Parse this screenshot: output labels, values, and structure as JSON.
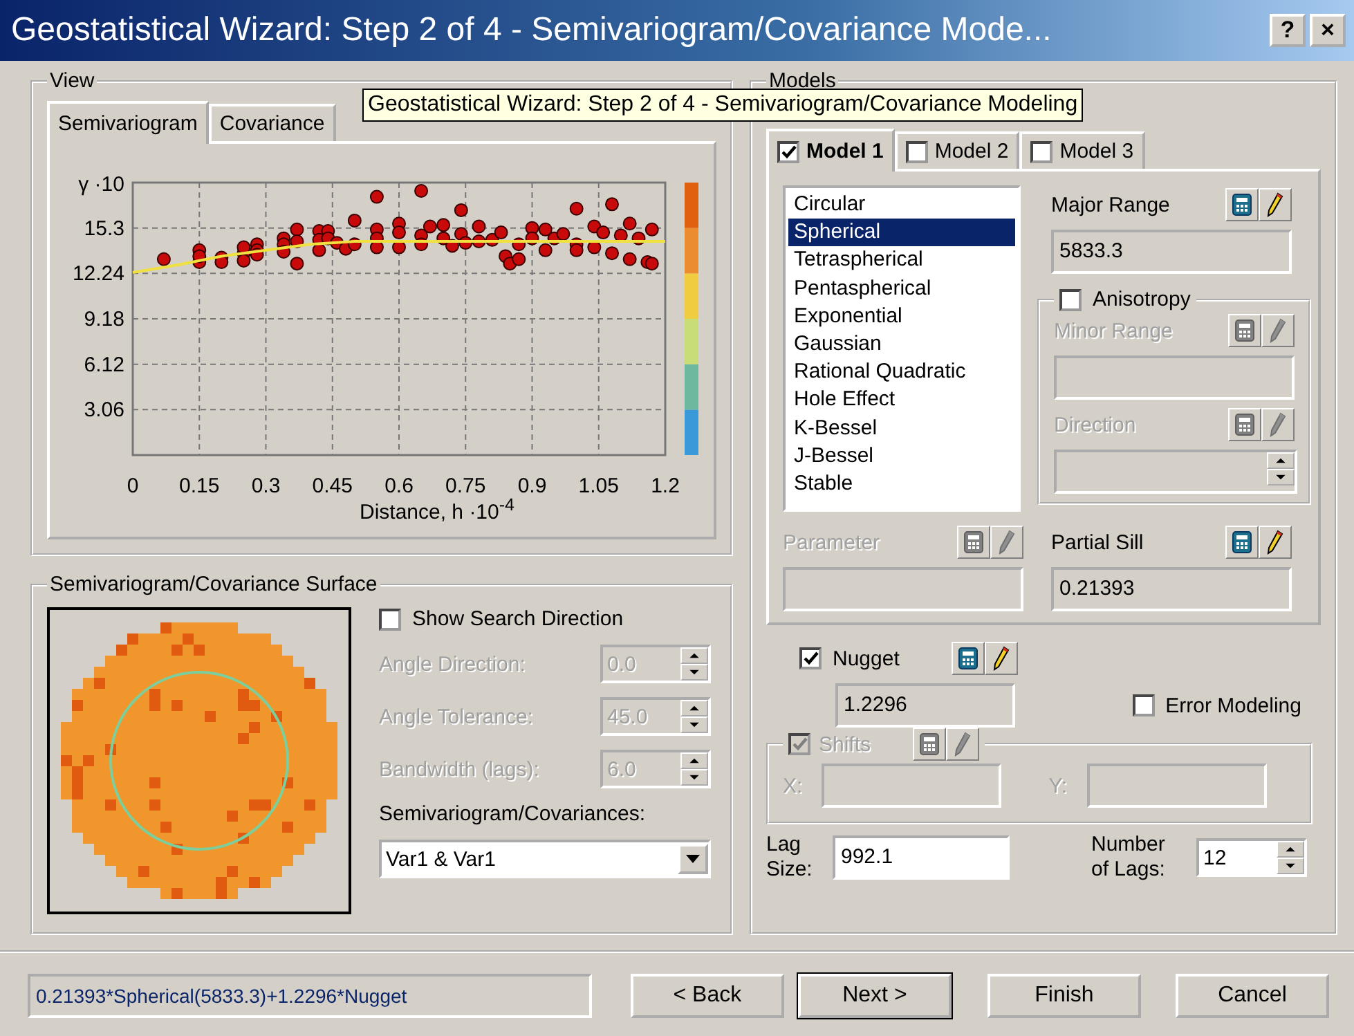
{
  "window": {
    "title": "Geostatistical Wizard: Step 2 of 4 - Semivariogram/Covariance Mode...",
    "help_button": "?",
    "close_button": "×"
  },
  "tooltip": {
    "text": "Geostatistical Wizard: Step 2 of 4 - Semivariogram/Covariance Modeling"
  },
  "view": {
    "title": "View",
    "tabs": [
      {
        "label": "Semivariogram",
        "selected": true
      },
      {
        "label": "Covariance",
        "selected": false
      }
    ],
    "chart_data": {
      "type": "scatter",
      "xlabel": "Distance, h ·10$^{-4}$",
      "ylabel": "γ ·10",
      "grid": true,
      "xlim": [
        0,
        1.2
      ],
      "ylim": [
        0,
        18.36
      ],
      "xticks": [
        0,
        0.15,
        0.3,
        0.45,
        0.6,
        0.75,
        0.9,
        1.05,
        1.2
      ],
      "yticks": [
        3.06,
        6.12,
        9.18,
        12.24,
        15.3
      ],
      "series": [
        {
          "color": "#c80a0a",
          "x": [
            0.07,
            0.15,
            0.15,
            0.15,
            0.2,
            0.2,
            0.25,
            0.25,
            0.25,
            0.28,
            0.28,
            0.28,
            0.34,
            0.34,
            0.34,
            0.37,
            0.37,
            0.37,
            0.42,
            0.42,
            0.42,
            0.44,
            0.44,
            0.46,
            0.48,
            0.5,
            0.5,
            0.55,
            0.55,
            0.55,
            0.55,
            0.6,
            0.6,
            0.6,
            0.65,
            0.65,
            0.65,
            0.67,
            0.7,
            0.7,
            0.72,
            0.74,
            0.74,
            0.75,
            0.78,
            0.78,
            0.81,
            0.83,
            0.84,
            0.85,
            0.87,
            0.87,
            0.9,
            0.9,
            0.93,
            0.93,
            0.95,
            0.97,
            1.0,
            1.0,
            1.0,
            1.04,
            1.04,
            1.06,
            1.08,
            1.08,
            1.1,
            1.12,
            1.12,
            1.14,
            1.16,
            1.17,
            1.17
          ],
          "values": [
            13.2,
            13.8,
            13.0,
            13.4,
            13.3,
            13.0,
            13.6,
            14.0,
            13.1,
            14.2,
            13.8,
            13.5,
            14.6,
            14.2,
            13.7,
            15.2,
            14.4,
            12.9,
            15.1,
            14.5,
            13.8,
            15.1,
            14.6,
            14.3,
            13.9,
            15.8,
            14.2,
            17.4,
            15.2,
            14.6,
            14.0,
            15.6,
            15.0,
            14.0,
            17.8,
            14.8,
            14.2,
            15.4,
            15.5,
            14.6,
            14.1,
            16.5,
            14.9,
            14.3,
            15.4,
            14.4,
            14.5,
            15.0,
            13.4,
            12.9,
            14.2,
            13.2,
            15.3,
            14.6,
            15.2,
            13.8,
            14.6,
            14.9,
            16.6,
            14.2,
            13.8,
            15.4,
            14.0,
            15.0,
            16.9,
            13.6,
            14.8,
            15.6,
            13.2,
            14.6,
            13.0,
            15.2,
            12.9
          ]
        },
        {
          "type": "line",
          "color": "#f0e040",
          "x": [
            0,
            0.1,
            0.2,
            0.3,
            0.4,
            0.5,
            0.6,
            0.7,
            0.9,
            1.2
          ],
          "values": [
            12.3,
            12.8,
            13.4,
            13.8,
            14.2,
            14.4,
            14.4,
            14.4,
            14.4,
            14.4
          ]
        }
      ]
    }
  },
  "surface": {
    "title": "Semivariogram/Covariance Surface",
    "show_search_direction": {
      "label": "Show Search Direction",
      "checked": false
    },
    "params": [
      {
        "label": "Angle Direction:",
        "value": "0.0",
        "disabled": true
      },
      {
        "label": "Angle Tolerance:",
        "value": "45.0",
        "disabled": true
      },
      {
        "label": "Bandwidth (lags):",
        "value": "6.0",
        "disabled": true
      }
    ],
    "dropdown_label": "Semivariogram/Covariances:",
    "dropdown_value": "Var1 & Var1"
  },
  "models": {
    "title": "Models",
    "tabs": [
      {
        "label": "Model 1",
        "checked": true,
        "selected": true
      },
      {
        "label": "Model 2",
        "checked": false,
        "selected": false
      },
      {
        "label": "Model 3",
        "checked": false,
        "selected": false
      }
    ],
    "model_types": [
      {
        "label": "Circular",
        "selected": false
      },
      {
        "label": "Spherical",
        "selected": true
      },
      {
        "label": "Tetraspherical",
        "selected": false
      },
      {
        "label": "Pentaspherical",
        "selected": false
      },
      {
        "label": "Exponential",
        "selected": false
      },
      {
        "label": "Gaussian",
        "selected": false
      },
      {
        "label": "Rational Quadratic",
        "selected": false
      },
      {
        "label": "Hole Effect",
        "selected": false
      },
      {
        "label": "K-Bessel",
        "selected": false
      },
      {
        "label": "J-Bessel",
        "selected": false
      },
      {
        "label": "Stable",
        "selected": false
      }
    ],
    "major_range": {
      "label": "Major Range",
      "value": "5833.3",
      "disabled": false
    },
    "anisotropy": {
      "label": "Anisotropy",
      "checked": false
    },
    "minor_range": {
      "label": "Minor Range",
      "disabled": true
    },
    "direction": {
      "label": "Direction",
      "disabled": true
    },
    "parameter": {
      "label": "Parameter",
      "disabled": true
    },
    "partial_sill": {
      "label": "Partial Sill",
      "value": "0.21393",
      "disabled": false
    },
    "nugget": {
      "label": "Nugget",
      "checked": true,
      "value": "1.2296",
      "disabled": false
    },
    "error_modeling": {
      "label": "Error Modeling",
      "checked": false
    },
    "shifts": {
      "label": "Shifts",
      "checked": true,
      "disabled": true,
      "x_label": "X:",
      "y_label": "Y:"
    },
    "lag_size": {
      "label": "Lag Size:",
      "value": "992.1"
    },
    "number_of_lags": {
      "label": "Number of Lags:",
      "value": "12"
    }
  },
  "footer": {
    "formula": "0.21393*Spherical(5833.3)+1.2296*Nugget",
    "buttons": [
      {
        "label": "< Back",
        "default": false
      },
      {
        "label": "Next >",
        "default": true
      },
      {
        "label": "Finish",
        "default": false
      },
      {
        "label": "Cancel",
        "default": false
      }
    ]
  }
}
